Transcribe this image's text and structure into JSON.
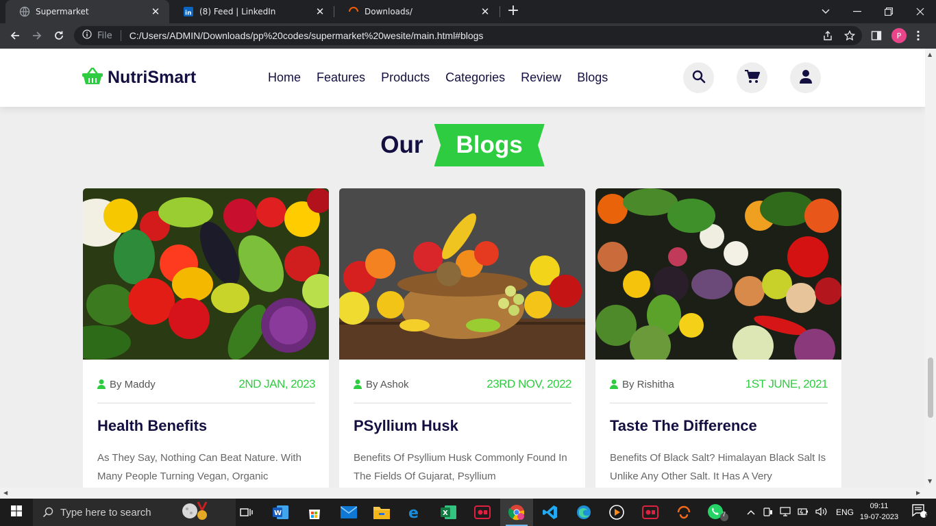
{
  "browser": {
    "tabs": [
      {
        "title": "Supermarket",
        "active": true
      },
      {
        "title": "(8) Feed | LinkedIn",
        "active": false
      },
      {
        "title": "Downloads/",
        "active": false
      }
    ],
    "omnibox": {
      "scheme_label": "File",
      "url": "C:/Users/ADMIN/Downloads/pp%20codes/supermarket%20wesite/main.html#blogs"
    },
    "profile_initial": "P"
  },
  "site": {
    "brand": "NutriSmart",
    "nav": [
      "Home",
      "Features",
      "Products",
      "Categories",
      "Review",
      "Blogs"
    ],
    "accent_color": "#2ecc40",
    "dark_color": "#130f40"
  },
  "blogs_section": {
    "heading_plain": "Our",
    "heading_highlight": "Blogs",
    "cards": [
      {
        "author": "By Maddy",
        "date": "2ND JAN, 2023",
        "title": "Health Benefits",
        "excerpt": "As They Say, Nothing Can Beat Nature. With Many People Turning Vegan, Organic",
        "image": "vegetables-and-fruits-photo"
      },
      {
        "author": "By Ashok",
        "date": "23RD NOV, 2022",
        "title": "PSyllium Husk",
        "excerpt": "Benefits Of Psyllium Husk Commonly Found In The Fields Of Gujarat, Psyllium",
        "image": "fruit-basket-photo"
      },
      {
        "author": "By Rishitha",
        "date": "1ST JUNE, 2021",
        "title": "Taste The Difference",
        "excerpt": "Benefits Of Black Salt? Himalayan Black Salt Is Unlike Any Other Salt. It Has A Very",
        "image": "mixed-vegetables-photo"
      }
    ]
  },
  "taskbar": {
    "search_placeholder": "Type here to search",
    "language": "ENG",
    "time": "09:11",
    "date": "19-07-2023",
    "whatsapp_badge": "7",
    "notifications_badge": "6"
  }
}
